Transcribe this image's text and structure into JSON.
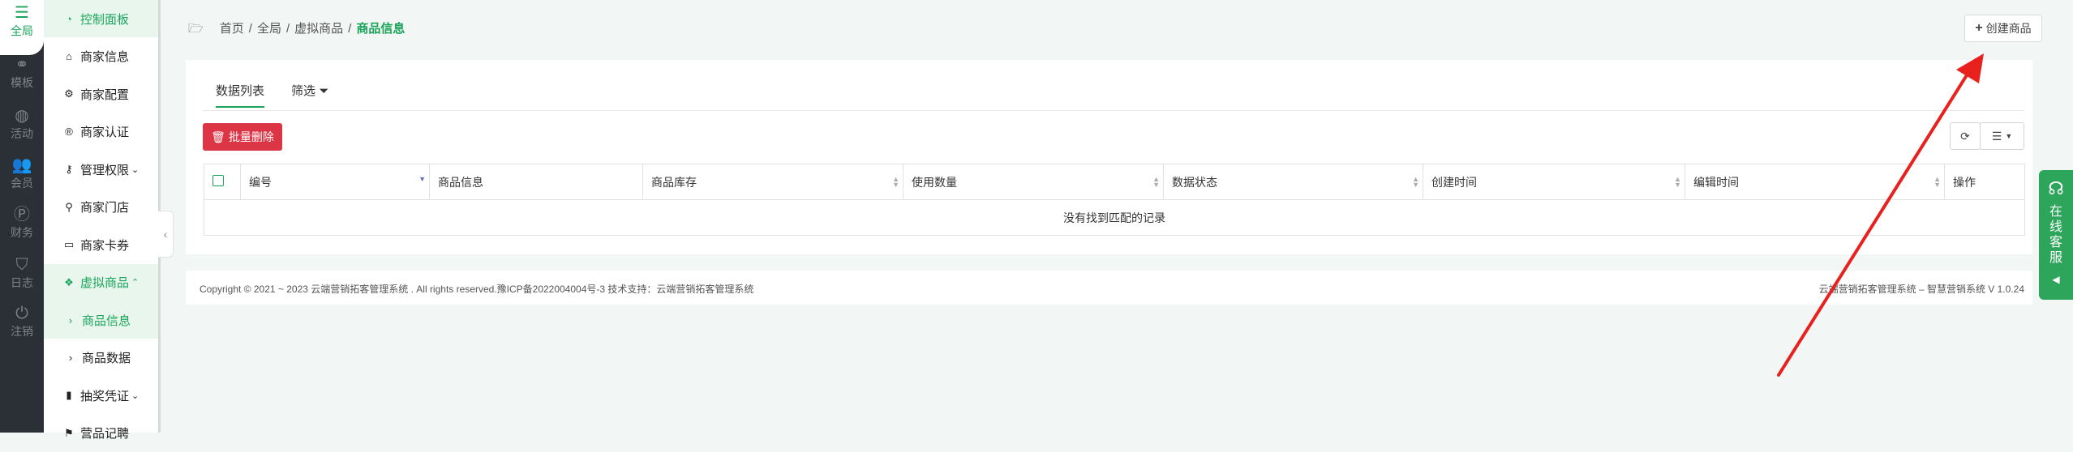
{
  "rail": [
    {
      "label": "全局",
      "icon": "sliders-icon",
      "glyph": "☰",
      "active": true
    },
    {
      "label": "模板",
      "icon": "sitemap-icon",
      "glyph": "⚭"
    },
    {
      "label": "活动",
      "icon": "globe-icon",
      "glyph": "◍"
    },
    {
      "label": "会员",
      "icon": "users-icon",
      "glyph": "👥"
    },
    {
      "label": "财务",
      "icon": "paypal-icon",
      "glyph": "Ⓟ"
    },
    {
      "label": "日志",
      "icon": "shield-icon",
      "glyph": "⛉"
    },
    {
      "label": "注销",
      "icon": "power-icon",
      "glyph": "⏻"
    }
  ],
  "menu": [
    {
      "label": "控制面板",
      "icon": "dashboard-icon",
      "glyph": "◔",
      "style": "green"
    },
    {
      "label": "商家信息",
      "icon": "home-icon",
      "glyph": "⌂"
    },
    {
      "label": "商家配置",
      "icon": "cogs-icon",
      "glyph": "⚙"
    },
    {
      "label": "商家认证",
      "icon": "registered-icon",
      "glyph": "®"
    },
    {
      "label": "管理权限",
      "icon": "key-icon",
      "glyph": "⚷",
      "caret": "⌄"
    },
    {
      "label": "商家门店",
      "icon": "map-marker-icon",
      "glyph": "⚲"
    },
    {
      "label": "商家卡券",
      "icon": "credit-card-icon",
      "glyph": "▭"
    },
    {
      "label": "虚拟商品",
      "icon": "dropbox-icon",
      "glyph": "❖",
      "style": "green",
      "caret": "⌃"
    },
    {
      "label": "商品信息",
      "icon": "chevron-right-icon",
      "glyph": "›",
      "style": "green sub"
    },
    {
      "label": "商品数据",
      "icon": "chevron-right-icon",
      "glyph": "›",
      "style": "sub"
    },
    {
      "label": "抽奖凭证",
      "icon": "bookmark-icon",
      "glyph": "▮",
      "caret": "⌄"
    },
    {
      "label": "营品记聘",
      "icon": "tag-icon",
      "glyph": "⚑"
    }
  ],
  "breadcrumb": {
    "items": [
      "首页",
      "全局",
      "虚拟商品"
    ],
    "current": "商品信息"
  },
  "create_button": "创建商品",
  "tabs": [
    "数据列表",
    "筛选"
  ],
  "batch_delete": "批量删除",
  "table": {
    "columns": [
      "编号",
      "商品信息",
      "商品库存",
      "使用数量",
      "数据状态",
      "创建时间",
      "编辑时间",
      "操作"
    ],
    "empty_text": "没有找到匹配的记录"
  },
  "footer": {
    "left": "Copyright © 2021 ~ 2023 云端营销拓客管理系统 . All rights reserved.豫ICP备2022004004号-3 技术支持：云端营销拓客管理系统",
    "right": "云端营销拓客管理系统 – 智慧营销系统 V 1.0.24"
  },
  "service": {
    "label": "在线客服"
  },
  "colors": {
    "accent": "#1aa55a",
    "danger": "#dc3545",
    "rail": "#2b2f36",
    "annotation_arrow": "#e8211e"
  }
}
